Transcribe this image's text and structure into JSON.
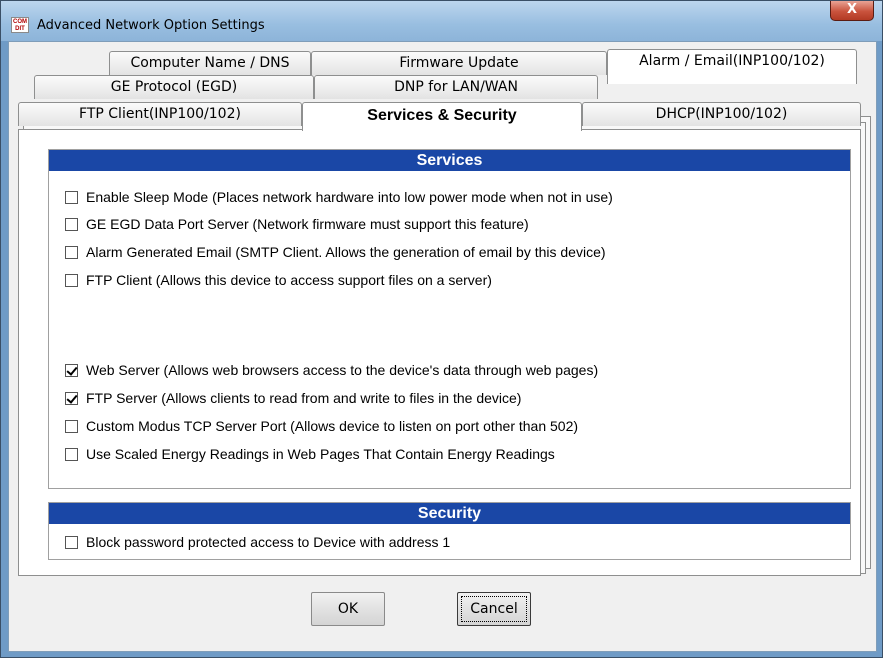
{
  "window": {
    "title": "Advanced Network Option Settings",
    "icon_text": "COM DIT",
    "close_label": "X"
  },
  "tabs": {
    "row1": [
      {
        "label": "Computer Name / DNS"
      },
      {
        "label": "Firmware Update"
      },
      {
        "label": "Alarm / Email(INP100/102)"
      }
    ],
    "row2": [
      {
        "label": "GE Protocol (EGD)"
      },
      {
        "label": "DNP for LAN/WAN"
      }
    ],
    "row3": [
      {
        "label": "FTP Client(INP100/102)"
      },
      {
        "label": "Services & Security",
        "selected": true
      },
      {
        "label": "DHCP(INP100/102)"
      }
    ]
  },
  "services": {
    "header": "Services",
    "items": [
      {
        "label": "Enable Sleep Mode (Places network hardware into low power mode when not in use)",
        "checked": false
      },
      {
        "label": "GE EGD Data Port Server (Network firmware must support this feature)",
        "checked": false
      },
      {
        "label": "Alarm Generated Email (SMTP Client. Allows the generation of email by this device)",
        "checked": false
      },
      {
        "label": "FTP Client (Allows this device to access support files on a server)",
        "checked": false
      },
      {
        "label": "Web Server (Allows web browsers access to the device's data through web pages)",
        "checked": true
      },
      {
        "label": "FTP Server (Allows clients to read from and write to files in the device)",
        "checked": true
      },
      {
        "label": "Custom Modus TCP Server Port (Allows device to listen on port other than 502)",
        "checked": false
      },
      {
        "label": "Use Scaled Energy Readings in Web Pages That Contain Energy Readings",
        "checked": false
      }
    ]
  },
  "security": {
    "header": "Security",
    "items": [
      {
        "label": "Block password protected access to Device with  address 1",
        "checked": false
      }
    ]
  },
  "buttons": {
    "ok": "OK",
    "cancel": "Cancel"
  },
  "colors": {
    "section_header": "#1a47a6",
    "title_bar": "#98bee0",
    "close_button": "#c9533d"
  }
}
